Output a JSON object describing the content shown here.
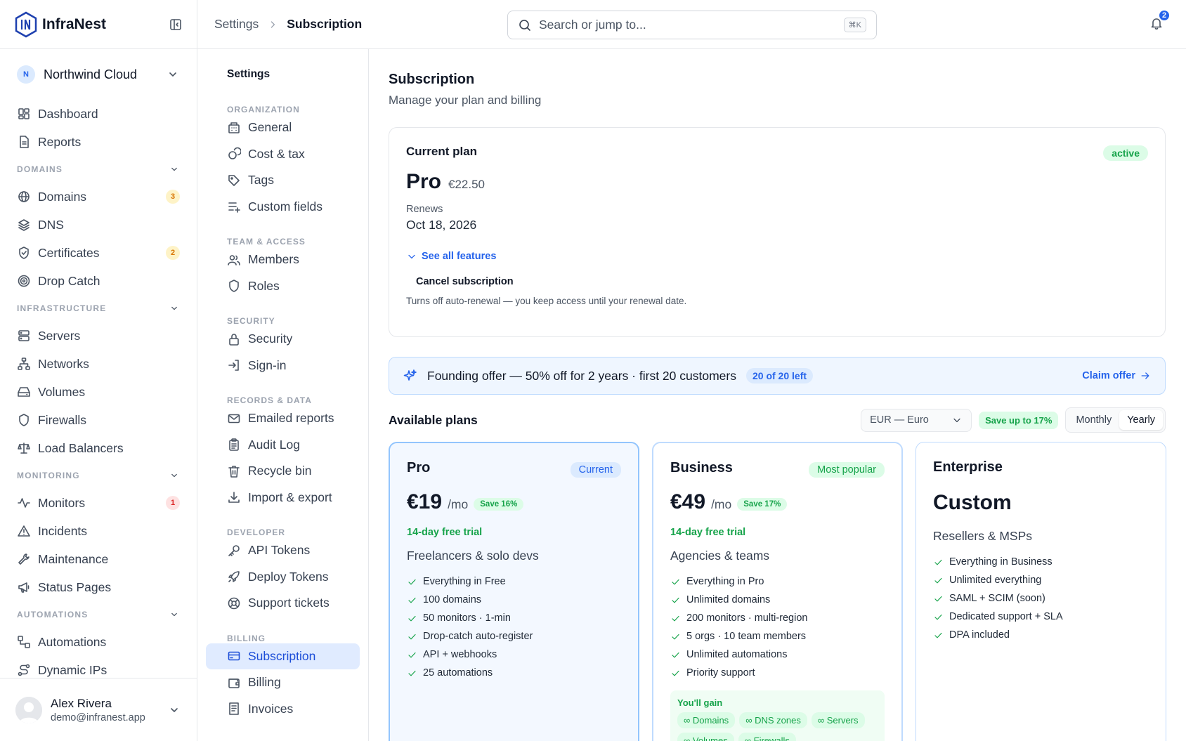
{
  "brand": {
    "name": "InfraNest"
  },
  "org": {
    "initial": "N",
    "name": "Northwind Cloud"
  },
  "sidebar": {
    "top": [
      {
        "label": "Dashboard",
        "icon": "dashboard-icon"
      },
      {
        "label": "Reports",
        "icon": "document-icon"
      }
    ],
    "sections": [
      {
        "title": "DOMAINS",
        "items": [
          {
            "label": "Domains",
            "icon": "globe-icon",
            "badge": "3",
            "badge_color": "amber"
          },
          {
            "label": "DNS",
            "icon": "layers-icon"
          },
          {
            "label": "Certificates",
            "icon": "shield-check-icon",
            "badge": "2",
            "badge_color": "amber"
          },
          {
            "label": "Drop Catch",
            "icon": "target-icon"
          }
        ]
      },
      {
        "title": "INFRASTRUCTURE",
        "items": [
          {
            "label": "Servers",
            "icon": "server-icon"
          },
          {
            "label": "Networks",
            "icon": "network-icon"
          },
          {
            "label": "Volumes",
            "icon": "drive-icon"
          },
          {
            "label": "Firewalls",
            "icon": "shield-icon"
          },
          {
            "label": "Load Balancers",
            "icon": "scale-icon"
          }
        ]
      },
      {
        "title": "MONITORING",
        "items": [
          {
            "label": "Monitors",
            "icon": "activity-icon",
            "badge": "1",
            "badge_color": "red"
          },
          {
            "label": "Incidents",
            "icon": "warning-icon"
          },
          {
            "label": "Maintenance",
            "icon": "wrench-icon"
          },
          {
            "label": "Status Pages",
            "icon": "megaphone-icon"
          }
        ]
      },
      {
        "title": "AUTOMATIONS",
        "items": [
          {
            "label": "Automations",
            "icon": "workflow-icon"
          },
          {
            "label": "Dynamic IPs",
            "icon": "route-icon"
          }
        ]
      }
    ]
  },
  "user": {
    "name": "Alex Rivera",
    "email": "demo@infranest.app"
  },
  "topbar": {
    "crumb_parent": "Settings",
    "crumb_current": "Subscription",
    "search_placeholder": "Search or jump to...",
    "search_shortcut": "⌘K",
    "notif_count": "2"
  },
  "subnav": {
    "title": "Settings",
    "sections": [
      {
        "title": "ORGANIZATION",
        "items": [
          {
            "label": "General",
            "icon": "building-icon"
          },
          {
            "label": "Cost & tax",
            "icon": "coins-icon"
          },
          {
            "label": "Tags",
            "icon": "tag-icon"
          },
          {
            "label": "Custom fields",
            "icon": "list-plus-icon"
          }
        ]
      },
      {
        "title": "TEAM & ACCESS",
        "items": [
          {
            "label": "Members",
            "icon": "users-icon"
          },
          {
            "label": "Roles",
            "icon": "shield-icon"
          }
        ]
      },
      {
        "title": "SECURITY",
        "items": [
          {
            "label": "Security",
            "icon": "lock-icon"
          },
          {
            "label": "Sign-in",
            "icon": "login-icon"
          }
        ]
      },
      {
        "title": "RECORDS & DATA",
        "items": [
          {
            "label": "Emailed reports",
            "icon": "mail-icon"
          },
          {
            "label": "Audit Log",
            "icon": "clipboard-icon"
          },
          {
            "label": "Recycle bin",
            "icon": "trash-icon"
          },
          {
            "label": "Import & export",
            "icon": "download-icon"
          }
        ]
      },
      {
        "title": "DEVELOPER",
        "items": [
          {
            "label": "API Tokens",
            "icon": "key-icon"
          },
          {
            "label": "Deploy Tokens",
            "icon": "rocket-icon"
          },
          {
            "label": "Support tickets",
            "icon": "lifebuoy-icon"
          }
        ]
      },
      {
        "title": "BILLING",
        "items": [
          {
            "label": "Subscription",
            "icon": "credit-card-icon",
            "active": true
          },
          {
            "label": "Billing",
            "icon": "wallet-icon"
          },
          {
            "label": "Invoices",
            "icon": "receipt-icon"
          }
        ]
      }
    ]
  },
  "page": {
    "title": "Subscription",
    "subtitle": "Manage your plan and billing"
  },
  "current_plan": {
    "label": "Current plan",
    "status": "active",
    "name": "Pro",
    "price": "€22.50",
    "renews_label": "Renews",
    "renews_date": "Oct 18, 2026",
    "features_link": "See all features",
    "cancel_label": "Cancel subscription",
    "cancel_note": "Turns off auto-renewal — you keep access until your renewal date."
  },
  "offer": {
    "text": "Founding offer — 50% off for 2 years · first 20 customers",
    "remaining": "20 of 20 left",
    "cta": "Claim offer"
  },
  "plans_bar": {
    "title": "Available plans",
    "currency": "EUR — Euro",
    "save": "Save up to 17%",
    "monthly": "Monthly",
    "yearly": "Yearly",
    "selected": "Yearly"
  },
  "plans": {
    "pro": {
      "name": "Pro",
      "tag": "Current",
      "price": "€19",
      "per": "/mo",
      "save": "Save 16%",
      "trial": "14-day free trial",
      "audience": "Freelancers & solo devs",
      "features": [
        "Everything in Free",
        "100 domains",
        "50 monitors · 1-min",
        "Drop-catch auto-register",
        "API + webhooks",
        "25 automations"
      ]
    },
    "business": {
      "name": "Business",
      "tag": "Most popular",
      "price": "€49",
      "per": "/mo",
      "save": "Save 17%",
      "trial": "14-day free trial",
      "audience": "Agencies & teams",
      "features": [
        "Everything in Pro",
        "Unlimited domains",
        "200 monitors · multi-region",
        "5 orgs · 10 team members",
        "Unlimited automations",
        "Priority support"
      ],
      "gain_label": "You'll gain",
      "gain_chips": [
        "∞ Domains",
        "∞ DNS zones",
        "∞ Servers",
        "∞ Volumes",
        "∞ Firewalls"
      ]
    },
    "enterprise": {
      "name": "Enterprise",
      "price": "Custom",
      "audience": "Resellers & MSPs",
      "features": [
        "Everything in Business",
        "Unlimited everything",
        "SAML + SCIM (soon)",
        "Dedicated support + SLA",
        "DPA included"
      ]
    }
  },
  "colors": {
    "accent": "#2563eb",
    "success": "#16a34a",
    "active_nav_bg": "#e0ebff"
  }
}
